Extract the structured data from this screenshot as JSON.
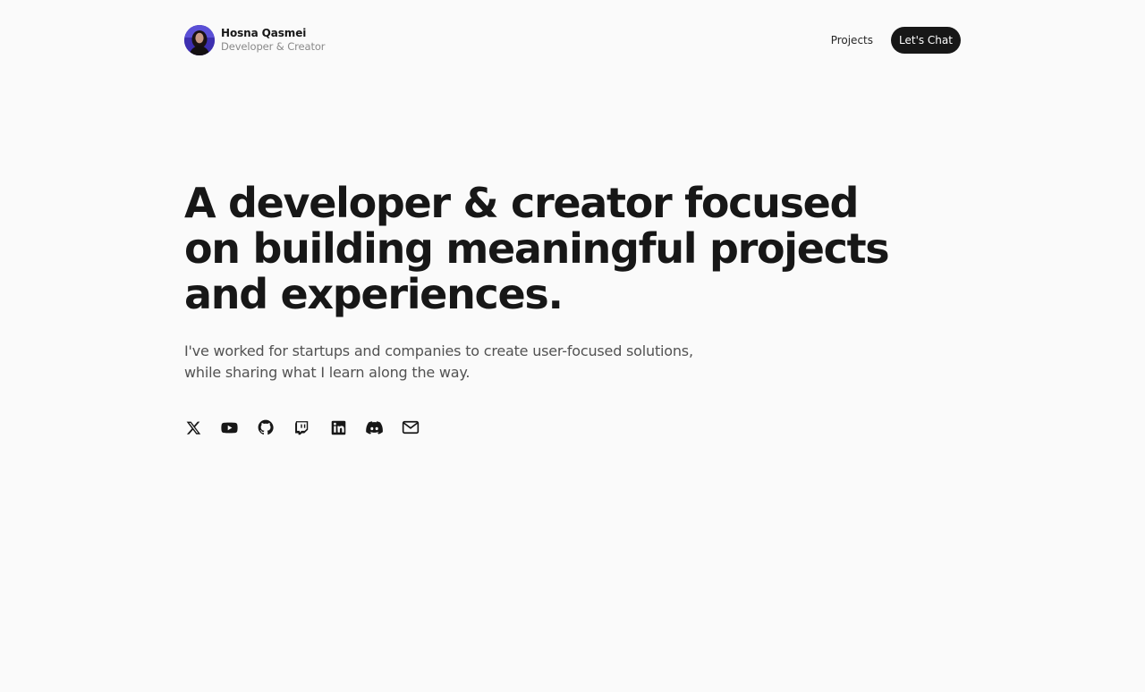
{
  "profile": {
    "name": "Hosna Qasmei",
    "role": "Developer & Creator"
  },
  "nav": {
    "projects_label": "Projects",
    "cta_label": "Let's Chat"
  },
  "hero": {
    "title": "A developer & creator focused on building meaningful projects and experiences.",
    "subtitle_line1": "I've worked for startups and companies to create user-focused solutions,",
    "subtitle_line2": "while sharing what I learn along the way."
  },
  "socials": [
    {
      "icon": "x-icon"
    },
    {
      "icon": "youtube-icon"
    },
    {
      "icon": "github-icon"
    },
    {
      "icon": "twitch-icon"
    },
    {
      "icon": "linkedin-icon"
    },
    {
      "icon": "discord-icon"
    },
    {
      "icon": "mail-icon"
    }
  ],
  "colors": {
    "background": "#fafafa",
    "text": "#171717",
    "muted": "#525252",
    "button_bg": "#171717",
    "button_text": "#ffffff"
  }
}
